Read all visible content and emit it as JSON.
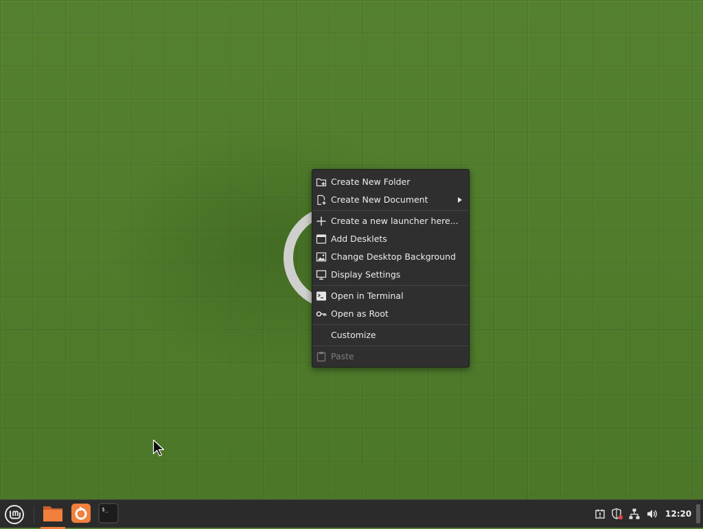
{
  "context_menu": {
    "items": [
      {
        "label": "Create New Folder",
        "icon": "folder-new-icon"
      },
      {
        "label": "Create New Document",
        "icon": "document-new-icon",
        "submenu": true
      },
      {
        "label": "Create a new launcher here...",
        "icon": "plus-icon"
      },
      {
        "label": "Add Desklets",
        "icon": "desklet-icon"
      },
      {
        "label": "Change Desktop Background",
        "icon": "image-icon"
      },
      {
        "label": "Display Settings",
        "icon": "monitor-icon"
      },
      {
        "label": "Open in Terminal",
        "icon": "terminal-icon"
      },
      {
        "label": "Open as Root",
        "icon": "key-icon"
      },
      {
        "label": "Customize",
        "icon": ""
      },
      {
        "label": "Paste",
        "icon": "clipboard-icon",
        "disabled": true
      }
    ]
  },
  "taskbar": {
    "menu_icon": "linux-mint-logo-icon",
    "launchers": [
      {
        "name": "files",
        "icon": "folder-icon",
        "color": "#f0803c"
      },
      {
        "name": "update-manager",
        "icon": "update-icon",
        "color": "#f0803c"
      },
      {
        "name": "terminal",
        "icon": "terminal-icon",
        "color": "#1c1c1c"
      }
    ],
    "tray": [
      "notification-icon",
      "shield-icon",
      "network-icon",
      "volume-icon"
    ],
    "clock": "12:20"
  },
  "colors": {
    "accent": "#f0803c",
    "desktop_green": "#4f7a2c",
    "menu_bg": "#2f2f2f",
    "panel_bg": "#2b2b2b"
  }
}
